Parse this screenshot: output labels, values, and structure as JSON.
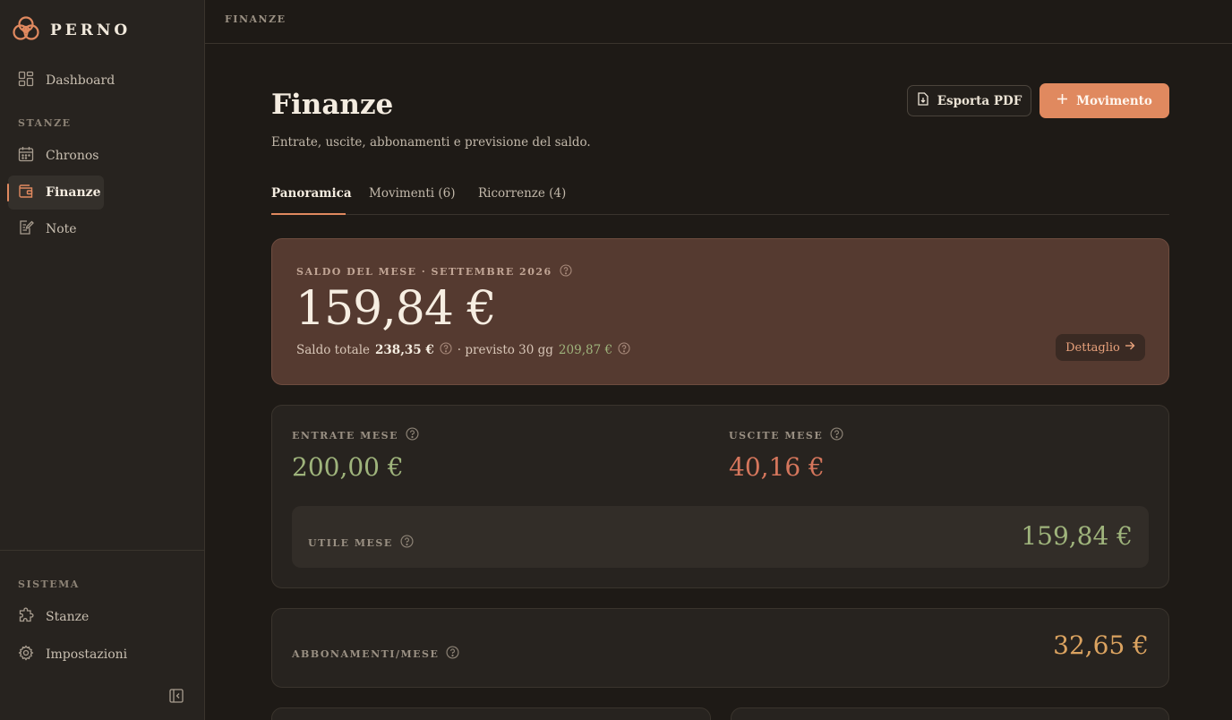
{
  "brand": {
    "name": "PERNO",
    "accent": "#e0895f"
  },
  "sidebar": {
    "dashboard": "Dashboard",
    "rooms_label": "STANZE",
    "rooms": [
      {
        "label": "Chronos",
        "icon": "calendar-icon"
      },
      {
        "label": "Finanze",
        "icon": "wallet-icon",
        "active": true
      },
      {
        "label": "Note",
        "icon": "note-icon"
      }
    ],
    "system_label": "SISTEMA",
    "system": [
      {
        "label": "Stanze",
        "icon": "puzzle-icon"
      },
      {
        "label": "Impostazioni",
        "icon": "gear-icon"
      }
    ]
  },
  "topbar": {
    "title": "FINANZE"
  },
  "page": {
    "title": "Finanze",
    "subtitle": "Entrate, uscite, abbonamenti e previsione del saldo.",
    "export_label": "Esporta PDF",
    "new_label": "Movimento"
  },
  "tabs": [
    {
      "label": "Panoramica",
      "active": true
    },
    {
      "label": "Movimenti (6)"
    },
    {
      "label": "Ricorrenze (4)"
    }
  ],
  "balance": {
    "eyebrow": "SALDO DEL MESE · SETTEMBRE 2026",
    "value": "159,84 €",
    "total_label": "Saldo totale",
    "total_value": "238,35 €",
    "forecast_label": "· previsto 30 gg",
    "forecast_value": "209,87 €",
    "detail_label": "Dettaglio"
  },
  "flows": {
    "income_label": "ENTRATE MESE",
    "income_value": "200,00 €",
    "expense_label": "USCITE MESE",
    "expense_value": "40,16 €",
    "profit_label": "UTILE MESE",
    "profit_value": "159,84 €"
  },
  "subscriptions": {
    "label": "ABBONAMENTI/MESE",
    "value": "32,65 €"
  },
  "colors": {
    "positive": "#9fb47c",
    "negative": "#d5765c",
    "subscription": "#dba360",
    "balance_card": "#553a30"
  }
}
